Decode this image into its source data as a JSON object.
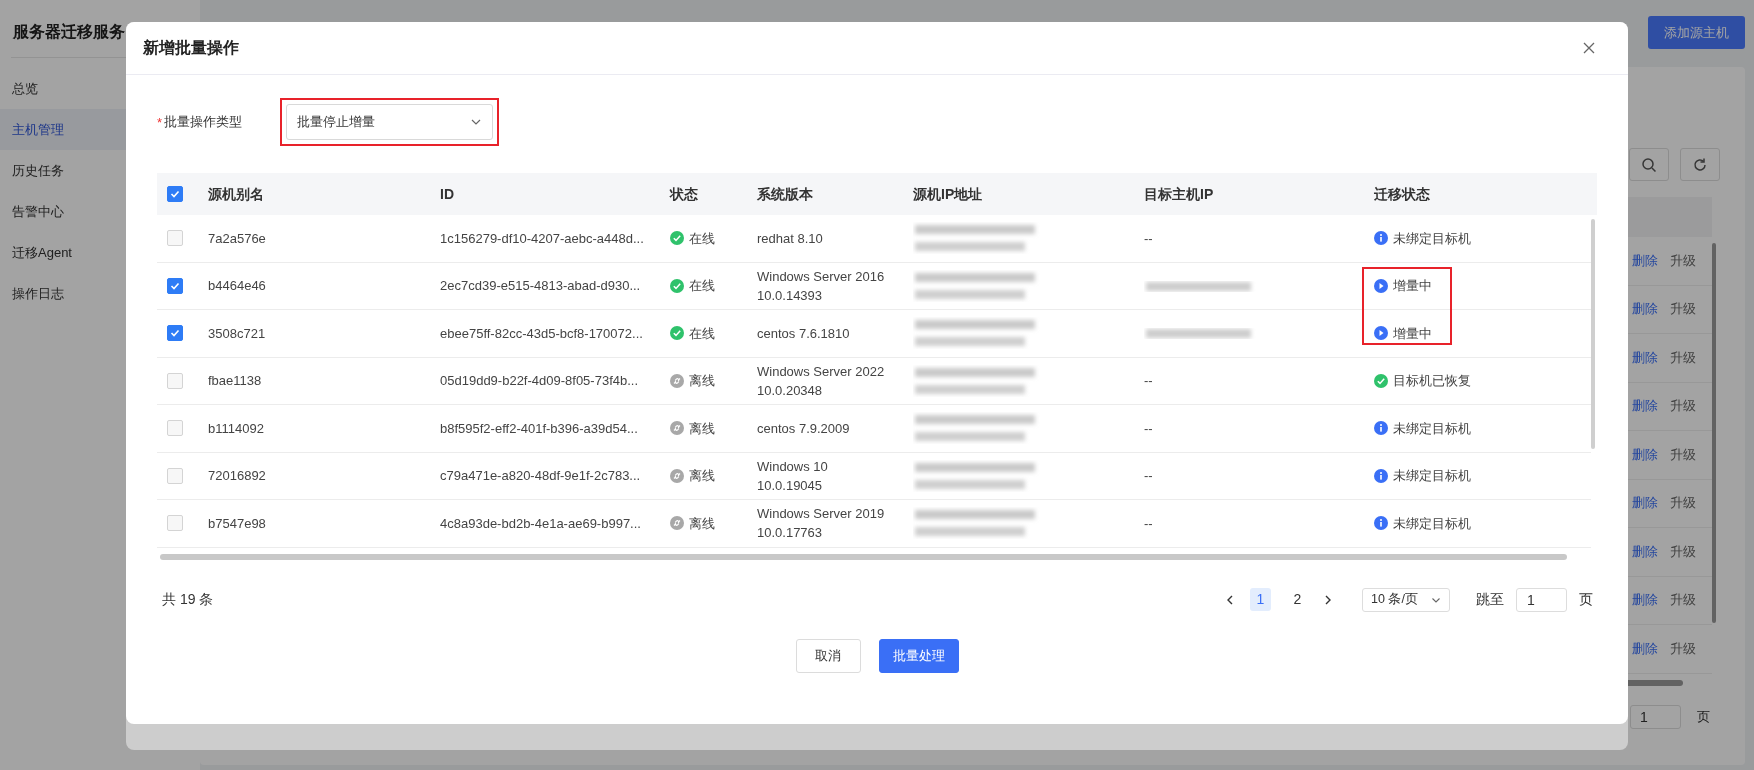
{
  "app": {
    "title": "服务器迁移服务",
    "menu": [
      {
        "label": "总览",
        "selected": false
      },
      {
        "label": "主机管理",
        "selected": true
      },
      {
        "label": "历史任务",
        "selected": false
      },
      {
        "label": "告警中心",
        "selected": false
      },
      {
        "label": "迁移Agent",
        "selected": false
      },
      {
        "label": "操作日志",
        "selected": false
      }
    ],
    "add_button": "添加源主机",
    "row_actions": [
      {
        "delete": "删除",
        "upgrade": "升级"
      },
      {
        "delete": "删除",
        "upgrade": "升级"
      },
      {
        "delete": "删除",
        "upgrade": "升级"
      },
      {
        "delete": "删除",
        "upgrade": "升级"
      },
      {
        "delete": "删除",
        "upgrade": "升级"
      },
      {
        "delete": "删除",
        "upgrade": "升级"
      },
      {
        "delete": "删除",
        "upgrade": "升级"
      },
      {
        "delete": "删除",
        "upgrade": "升级"
      },
      {
        "delete": "删除",
        "upgrade": "升级"
      }
    ],
    "jump_value": "1",
    "jump_suffix": "页"
  },
  "dialog": {
    "title": "新增批量操作",
    "form": {
      "label": "批量操作类型",
      "required_mark": "*",
      "value": "批量停止增量",
      "highlighted": true
    },
    "table": {
      "header_checked": true,
      "columns": [
        "源机别名",
        "ID",
        "状态",
        "系统版本",
        "源机IP地址",
        "目标主机IP",
        "迁移状态"
      ],
      "rows": [
        {
          "selected": false,
          "alias": "7a2a576e",
          "id": "1c156279-df10-4207-aebc-a448d...",
          "status": {
            "kind": "online",
            "label": "在线"
          },
          "os": "redhat 8.10",
          "target_ip": "--",
          "migration": {
            "kind": "info",
            "label": "未绑定目标机",
            "highlighted": false
          }
        },
        {
          "selected": true,
          "alias": "b4464e46",
          "id": "2ec7cd39-e515-4813-abad-d930...",
          "status": {
            "kind": "online",
            "label": "在线"
          },
          "os": "Windows Server 2016 10.0.14393",
          "migration": {
            "kind": "running",
            "label": "增量中",
            "highlighted": true
          }
        },
        {
          "selected": true,
          "alias": "3508c721",
          "id": "ebee75ff-82cc-43d5-bcf8-170072...",
          "status": {
            "kind": "online",
            "label": "在线"
          },
          "os": "centos 7.6.1810",
          "migration": {
            "kind": "running",
            "label": "增量中",
            "highlighted": true
          }
        },
        {
          "selected": false,
          "alias": "fbae1138",
          "id": "05d19dd9-b22f-4d09-8f05-73f4b...",
          "status": {
            "kind": "offline",
            "label": "离线"
          },
          "os": "Windows Server 2022 10.0.20348",
          "target_ip": "--",
          "migration": {
            "kind": "success",
            "label": "目标机已恢复",
            "highlighted": false
          }
        },
        {
          "selected": false,
          "alias": "b1114092",
          "id": "b8f595f2-eff2-401f-b396-a39d54...",
          "status": {
            "kind": "offline",
            "label": "离线"
          },
          "os": "centos 7.9.2009",
          "target_ip": "--",
          "migration": {
            "kind": "info",
            "label": "未绑定目标机",
            "highlighted": false
          }
        },
        {
          "selected": false,
          "alias": "72016892",
          "id": "c79a471e-a820-48df-9e1f-2c783...",
          "status": {
            "kind": "offline",
            "label": "离线"
          },
          "os": "Windows 10 10.0.19045",
          "target_ip": "--",
          "migration": {
            "kind": "info",
            "label": "未绑定目标机",
            "highlighted": false
          }
        },
        {
          "selected": false,
          "alias": "b7547e98",
          "id": "4c8a93de-bd2b-4e1a-ae69-b997...",
          "status": {
            "kind": "offline",
            "label": "离线"
          },
          "os": "Windows Server 2019 10.0.17763",
          "target_ip": "--",
          "migration": {
            "kind": "info",
            "label": "未绑定目标机",
            "highlighted": false
          }
        }
      ]
    },
    "footer": {
      "total": "共 19 条",
      "pages": [
        {
          "label": "1",
          "selected": true
        },
        {
          "label": "2",
          "selected": false
        }
      ],
      "page_size": "10 条/页",
      "jump_label": "跳至",
      "jump_value": "1",
      "jump_suffix": "页"
    },
    "buttons": [
      {
        "label": "取消",
        "kind": "default"
      },
      {
        "label": "批量处理",
        "kind": "primary"
      }
    ]
  }
}
